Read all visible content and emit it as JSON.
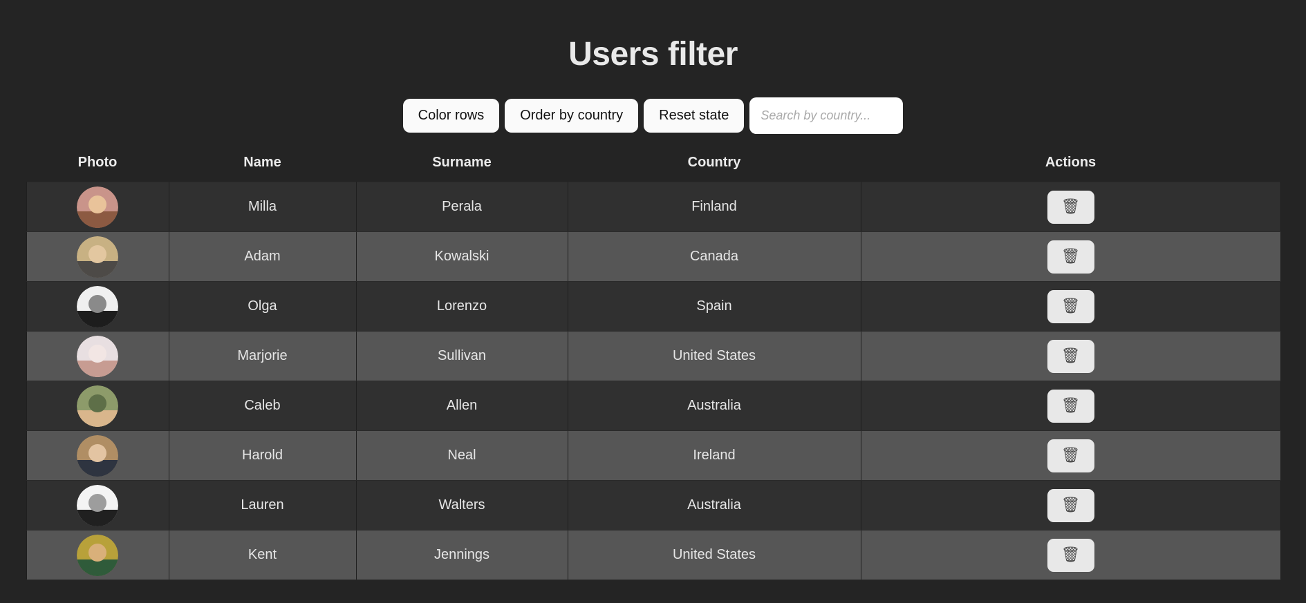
{
  "page": {
    "title": "Users filter",
    "background_color": "#242424",
    "text_color": "#e6e6e6"
  },
  "toolbar": {
    "color_rows_label": "Color rows",
    "order_by_country_label": "Order by country",
    "reset_state_label": "Reset state",
    "search": {
      "placeholder": "Search by country...",
      "value": ""
    },
    "button_background": "#fafafa",
    "button_text_color": "#111111"
  },
  "table": {
    "columns": [
      "Photo",
      "Name",
      "Surname",
      "Country",
      "Actions"
    ],
    "row_colors": {
      "odd": "#303030",
      "even": "#565656"
    },
    "delete_icon": "trash-icon",
    "delete_glyph": "🗑",
    "rows": [
      {
        "name": "Milla",
        "surname": "Perala",
        "country": "Finland",
        "avatar": "avatar-milla",
        "avatar_colors": [
          "#c9948a",
          "#8c5a42",
          "#e9c39a"
        ]
      },
      {
        "name": "Adam",
        "surname": "Kowalski",
        "country": "Canada",
        "avatar": "avatar-adam",
        "avatar_colors": [
          "#c8b183",
          "#4d4a47",
          "#e3c7a0"
        ]
      },
      {
        "name": "Olga",
        "surname": "Lorenzo",
        "country": "Spain",
        "avatar": "avatar-olga",
        "avatar_colors": [
          "#f0f0f0",
          "#1d1d1d",
          "#8a8a8a"
        ]
      },
      {
        "name": "Marjorie",
        "surname": "Sullivan",
        "country": "United States",
        "avatar": "avatar-marjorie",
        "avatar_colors": [
          "#e8dfe1",
          "#c79c92",
          "#f2e6e4"
        ]
      },
      {
        "name": "Caleb",
        "surname": "Allen",
        "country": "Australia",
        "avatar": "avatar-caleb",
        "avatar_colors": [
          "#8d9b6a",
          "#d9b68c",
          "#5e6f48"
        ]
      },
      {
        "name": "Harold",
        "surname": "Neal",
        "country": "Ireland",
        "avatar": "avatar-harold",
        "avatar_colors": [
          "#b08e64",
          "#2e3440",
          "#e3c4a2"
        ]
      },
      {
        "name": "Lauren",
        "surname": "Walters",
        "country": "Australia",
        "avatar": "avatar-lauren",
        "avatar_colors": [
          "#f4f4f4",
          "#202020",
          "#9d9d9d"
        ]
      },
      {
        "name": "Kent",
        "surname": "Jennings",
        "country": "United States",
        "avatar": "avatar-kent",
        "avatar_colors": [
          "#b8a13a",
          "#2f5b3a",
          "#d9b07a"
        ]
      }
    ]
  }
}
